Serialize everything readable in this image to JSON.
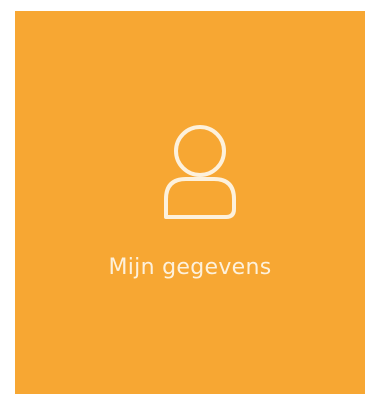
{
  "tile": {
    "label": "Mijn gegevens",
    "icon": "user-icon",
    "background_color": "#f7a733",
    "foreground_color": "#fdf1dc"
  }
}
